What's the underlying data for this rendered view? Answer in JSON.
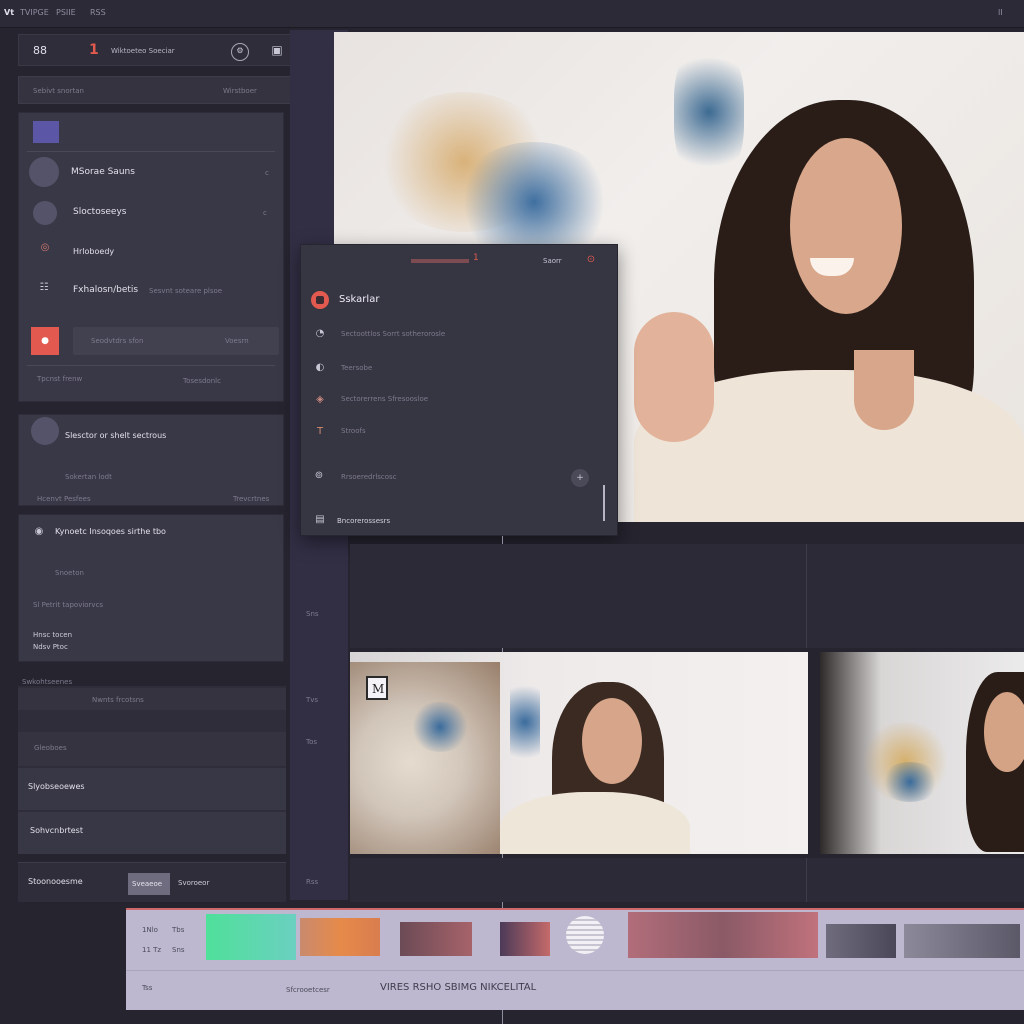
{
  "app": {
    "tab_labels": [
      "Vt",
      "TVIPGE",
      "PSIIE",
      "RSS"
    ],
    "corner_text": "II"
  },
  "toolbar": {
    "counter": "88",
    "marker": "1",
    "title": "Wiktoeteo Soeciar"
  },
  "search": {
    "placeholder": "Sebivt snortan",
    "right_label": "Wirstboer"
  },
  "left_list": {
    "items": [
      {
        "label": "",
        "meta": ""
      },
      {
        "label": "MSorae Sauns",
        "meta": "c"
      },
      {
        "label": "Sloctoseeys",
        "meta": "c"
      },
      {
        "label": "Hrloboedy",
        "meta": ""
      },
      {
        "label": "Fxhalosn/betis",
        "meta": "Sesvnt soteare plsoe"
      }
    ],
    "input_label": "Seodvtdrs sfon",
    "input_suffix": "Voesrn",
    "foot_left": "Tpcnst frenw",
    "foot_right": "Tosesdonlc"
  },
  "left_panel2": {
    "title": "Slesctor or shelt sectrous",
    "sub": "Sokertan lodt",
    "foot_left": "Hcenvt Pesfees",
    "foot_right": "Trevcrtnes"
  },
  "left_panel3": {
    "title": "Kynoetc Insoqoes sirthe tbo",
    "line1": "Snoeton",
    "line2": "Sl Petrit tapoviorvcs",
    "line3": "Hnsc tocen",
    "line4": "Ndsv Ptoc"
  },
  "left_lower": {
    "row1": "Swkohtseenes",
    "row1_right": "Nwnts frcotsns",
    "row2": "Gleoboes",
    "row3": "Slyobseoewes",
    "row4": "Sohvcnbrtest",
    "footer_label": "Stoonooesme",
    "footer_badge": "Sveaeoe",
    "footer_value": "Svoroeor"
  },
  "popup": {
    "header_label": "Saorr",
    "title": "Sskarlar",
    "items": [
      "Sectoottlos Sorrt sotherorosle",
      "Teersobe",
      "Sectorerrens Sfresoosloe",
      "Stroofs",
      "Rrsoeredrlscosc",
      "Bncorerossesrs"
    ]
  },
  "strip_labels": [
    "Sns",
    "Tvs",
    "Tos",
    "Rss"
  ],
  "timeline": {
    "row_labels": [
      "1Nlo",
      "11 Tz"
    ],
    "row_values": [
      "Tbs",
      "Sns"
    ],
    "footer_icon": "Tss",
    "footer_small": "Sfcrooetcesr",
    "footer_title": "VIRES RSHO SBIMG NIKCELITAL"
  },
  "thumb_badge": "M",
  "colors": {
    "accent": "#e25a4f",
    "panel": "#393846",
    "strip": "#322f45",
    "timeline": "#bdb8cf"
  }
}
